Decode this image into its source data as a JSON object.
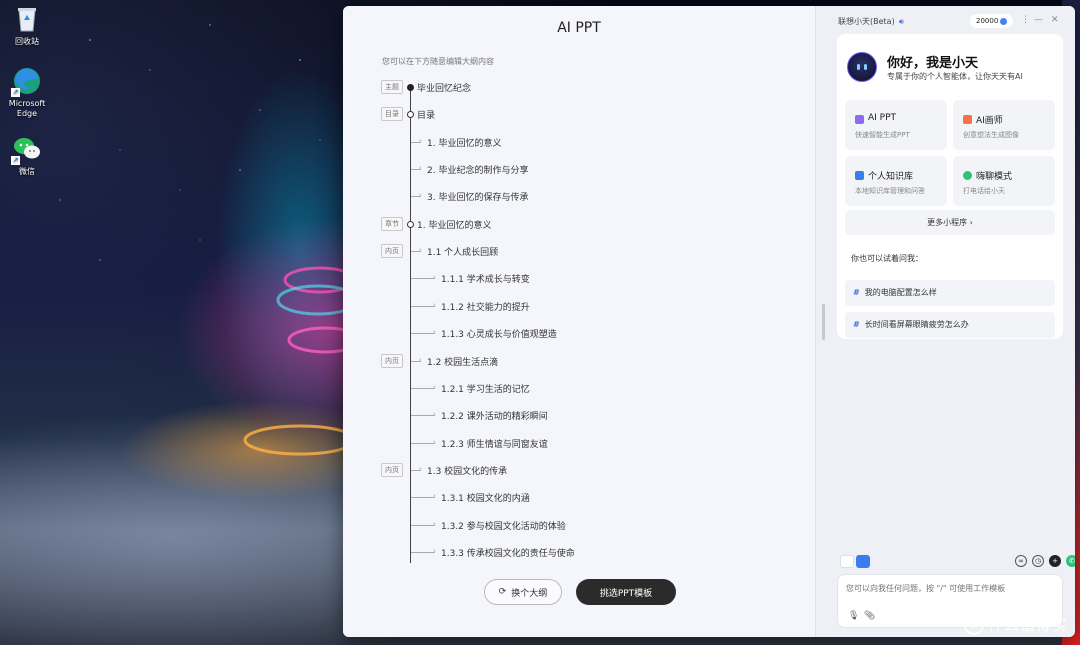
{
  "desktop": {
    "icons": [
      {
        "label": "回收站",
        "icon": "recycle-bin-icon"
      },
      {
        "label": "Microsoft Edge",
        "icon": "edge-icon"
      },
      {
        "label": "微信",
        "icon": "wechat-icon"
      }
    ],
    "watermark": "什么值得买"
  },
  "ppt": {
    "title": "AI PPT",
    "hint": "您可以在下方随意编辑大纲内容",
    "outline": [
      {
        "tag": "主题",
        "text": "毕业回忆纪念",
        "level": 0,
        "dot": "solid"
      },
      {
        "tag": "目录",
        "text": "目录",
        "level": 0,
        "dot": "hollow"
      },
      {
        "tag": "",
        "text": "1. 毕业回忆的意义",
        "level": 1
      },
      {
        "tag": "",
        "text": "2. 毕业纪念的制作与分享",
        "level": 1
      },
      {
        "tag": "",
        "text": "3. 毕业回忆的保存与传承",
        "level": 1
      },
      {
        "tag": "章节",
        "text": "1. 毕业回忆的意义",
        "level": 0,
        "dot": "hollow"
      },
      {
        "tag": "内页",
        "text": "1.1 个人成长回顾",
        "level": 1
      },
      {
        "tag": "",
        "text": "1.1.1 学术成长与转变",
        "level": 2
      },
      {
        "tag": "",
        "text": "1.1.2 社交能力的提升",
        "level": 2
      },
      {
        "tag": "",
        "text": "1.1.3 心灵成长与价值观塑造",
        "level": 2
      },
      {
        "tag": "内页",
        "text": "1.2 校园生活点滴",
        "level": 1
      },
      {
        "tag": "",
        "text": "1.2.1 学习生活的记忆",
        "level": 2
      },
      {
        "tag": "",
        "text": "1.2.2 课外活动的精彩瞬间",
        "level": 2
      },
      {
        "tag": "",
        "text": "1.2.3 师生情谊与同窗友谊",
        "level": 2
      },
      {
        "tag": "内页",
        "text": "1.3 校园文化的传承",
        "level": 1
      },
      {
        "tag": "",
        "text": "1.3.1 校园文化的内涵",
        "level": 2
      },
      {
        "tag": "",
        "text": "1.3.2 参与校园文化活动的体验",
        "level": 2
      },
      {
        "tag": "",
        "text": "1.3.3 传承校园文化的责任与使命",
        "level": 2
      }
    ],
    "change_button": "换个大纲",
    "choose_button": "挑选PPT模板"
  },
  "assistant": {
    "title": "联想小天(Beta)",
    "credits": "20000",
    "greeting": "你好，我是小天",
    "greeting_sub": "专属于你的个人智能体，让你天天有AI",
    "features": [
      {
        "label": "AI PPT",
        "desc": "快速智能生成PPT",
        "color": "#8b6cf0",
        "icon": "ppt-icon"
      },
      {
        "label": "AI画师",
        "desc": "创意想法生成图像",
        "color": "#f0734a",
        "icon": "painter-icon"
      },
      {
        "label": "个人知识库",
        "desc": "本地知识库管理和问答",
        "color": "#3b7cf0",
        "icon": "knowledge-icon"
      },
      {
        "label": "嗨聊模式",
        "desc": "打电话给小天",
        "color": "#2fc27a",
        "icon": "phone-icon"
      }
    ],
    "more_label": "更多小程序 ›",
    "try_label": "你也可以试着问我：",
    "suggestions": [
      "我的电脑配置怎么样",
      "长时间看屏幕眼睛疲劳怎么办"
    ],
    "input_placeholder": "您可以向我任何问题，按 \"/\" 可使用工作模板"
  }
}
